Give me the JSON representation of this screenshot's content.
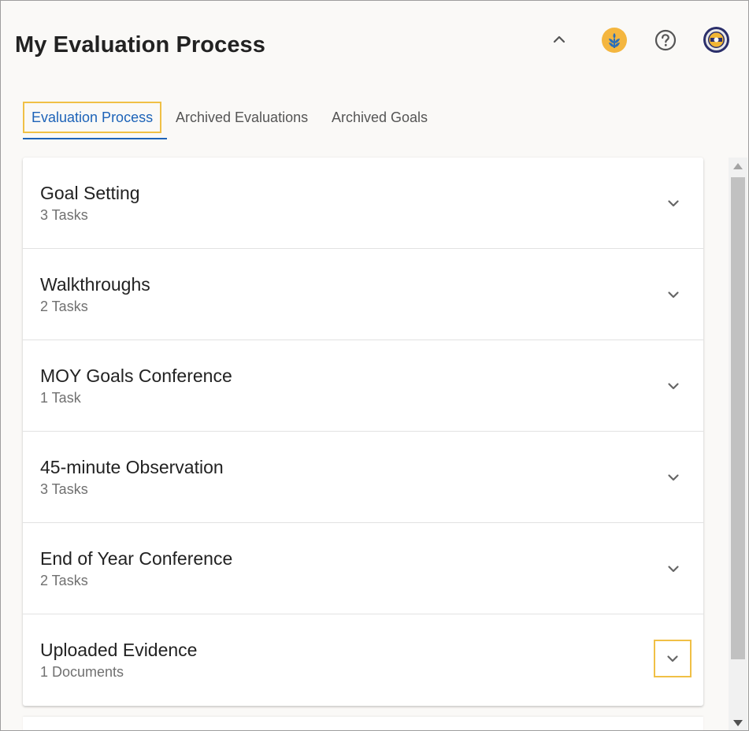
{
  "header": {
    "title": "My Evaluation Process",
    "icons": [
      "chevron-up-icon",
      "wheat-logo-icon",
      "help-circle-icon",
      "school-seal-avatar"
    ]
  },
  "tabs": [
    {
      "label": "Evaluation Process",
      "active": true
    },
    {
      "label": "Archived Evaluations",
      "active": false
    },
    {
      "label": "Archived Goals",
      "active": false
    }
  ],
  "sections": [
    {
      "title": "Goal Setting",
      "subtitle": "3 Tasks"
    },
    {
      "title": "Walkthroughs",
      "subtitle": "2 Tasks"
    },
    {
      "title": "MOY Goals Conference",
      "subtitle": "1 Task"
    },
    {
      "title": "45-minute Observation",
      "subtitle": "3 Tasks"
    },
    {
      "title": "End of Year Conference",
      "subtitle": "2 Tasks"
    },
    {
      "title": "Uploaded Evidence",
      "subtitle": "1 Documents"
    }
  ],
  "colors": {
    "accent": "#1d63b8",
    "focus_outline": "#f0c046",
    "brand": "#f4b63f"
  }
}
